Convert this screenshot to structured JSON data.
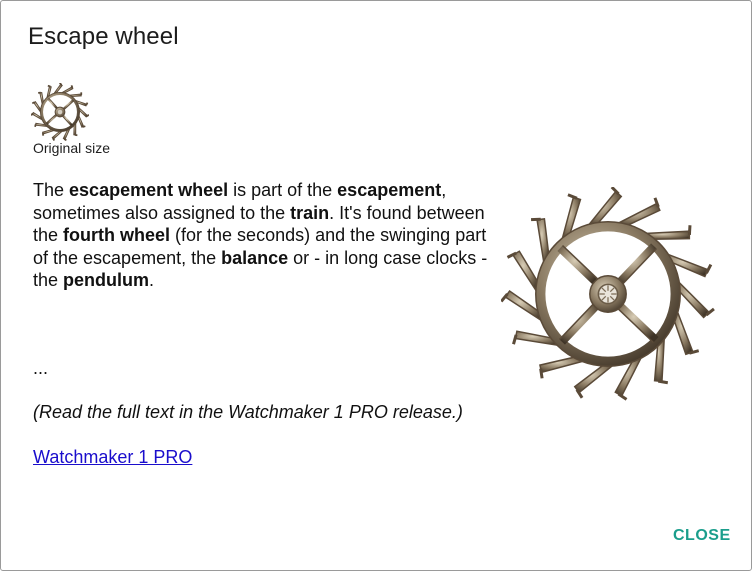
{
  "dialog": {
    "title": "Escape wheel",
    "thumbnail_caption": "Original size",
    "paragraph": {
      "p1": "The ",
      "b1": "escapement wheel",
      "p2": " is part of the ",
      "b2": "escapement",
      "p3": ", sometimes also assigned to the ",
      "b3": "train",
      "p4": ". It's found between the ",
      "b4": "fourth wheel",
      "p5": " (for the seconds) and the swinging part of the escapement, the ",
      "b5": "balance",
      "p6": " or - in long case clocks - the ",
      "b6": "pendulum",
      "p7": "."
    },
    "ellipsis": "...",
    "note": "(Read the full text in the Watchmaker 1 PRO release.)",
    "link_label": "Watchmaker 1 PRO",
    "close_label": "CLOSE"
  },
  "images": {
    "thumbnail": "escape-wheel-icon",
    "large": "escape-wheel-illustration"
  },
  "colors": {
    "link": "#1a0dcc",
    "close_button": "#1b9e8c",
    "wheel_metal": "#5a4a38"
  }
}
